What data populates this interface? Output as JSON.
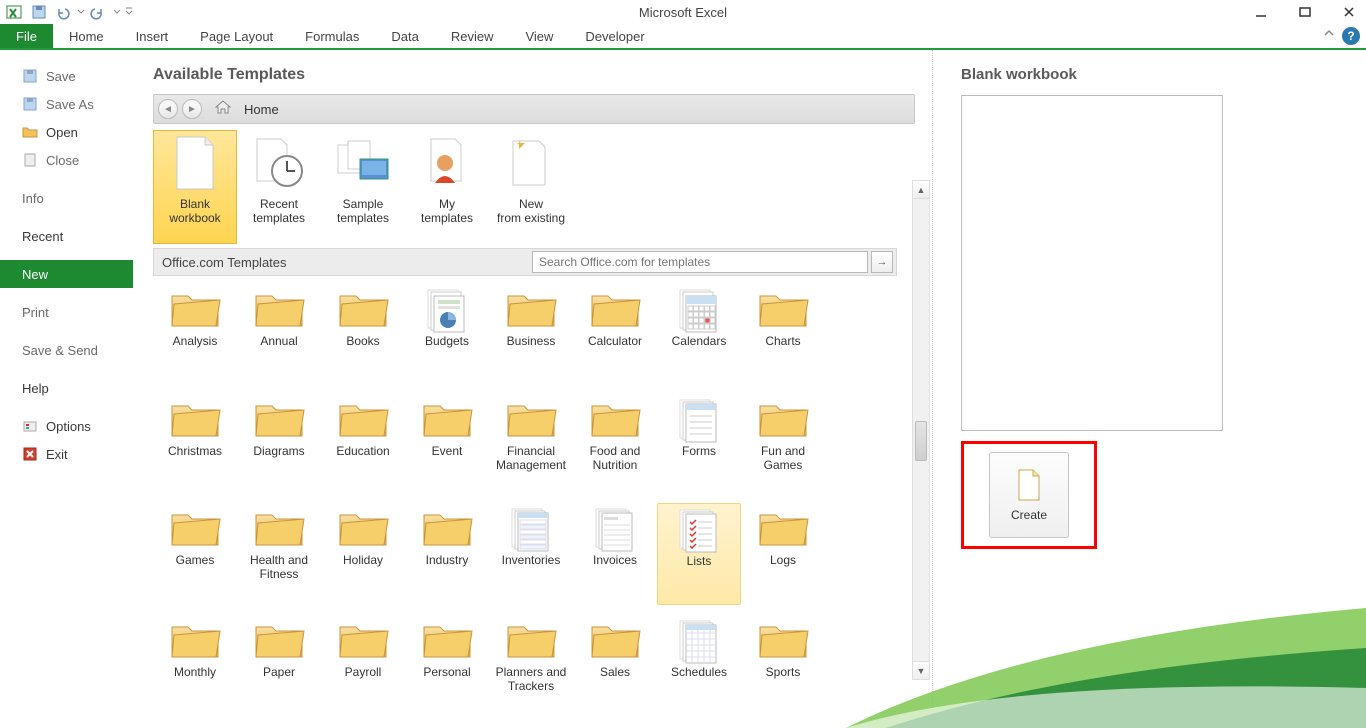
{
  "app": {
    "title": "Microsoft Excel"
  },
  "ribbon": {
    "file": "File",
    "tabs": [
      "Home",
      "Insert",
      "Page Layout",
      "Formulas",
      "Data",
      "Review",
      "View",
      "Developer"
    ]
  },
  "sidebar": {
    "save": "Save",
    "save_as": "Save As",
    "open": "Open",
    "close": "Close",
    "info": "Info",
    "recent": "Recent",
    "new": "New",
    "print": "Print",
    "save_send": "Save & Send",
    "help": "Help",
    "options": "Options",
    "exit": "Exit"
  },
  "templates": {
    "heading": "Available Templates",
    "breadcrumb": "Home",
    "top": [
      {
        "label": "Blank workbook",
        "icon": "blank-doc",
        "selected": true
      },
      {
        "label": "Recent templates",
        "icon": "recent-clock"
      },
      {
        "label": "Sample templates",
        "icon": "sample-gallery"
      },
      {
        "label": "My templates",
        "icon": "person-doc"
      },
      {
        "label": "New from existing",
        "icon": "star-doc"
      }
    ],
    "office_label": "Office.com Templates",
    "search_placeholder": "Search Office.com for templates",
    "categories": [
      {
        "label": "Analysis",
        "icon": "folder"
      },
      {
        "label": "Annual",
        "icon": "folder"
      },
      {
        "label": "Books",
        "icon": "folder"
      },
      {
        "label": "Budgets",
        "icon": "budget"
      },
      {
        "label": "Business",
        "icon": "folder"
      },
      {
        "label": "Calculator",
        "icon": "folder"
      },
      {
        "label": "Calendars",
        "icon": "calendar"
      },
      {
        "label": "Charts",
        "icon": "folder"
      },
      {
        "label": "Christmas",
        "icon": "folder"
      },
      {
        "label": "Diagrams",
        "icon": "folder"
      },
      {
        "label": "Education",
        "icon": "folder"
      },
      {
        "label": "Event",
        "icon": "folder"
      },
      {
        "label": "Financial Management",
        "icon": "folder"
      },
      {
        "label": "Food and Nutrition",
        "icon": "folder"
      },
      {
        "label": "Forms",
        "icon": "form"
      },
      {
        "label": "Fun and Games",
        "icon": "folder"
      },
      {
        "label": "Games",
        "icon": "folder"
      },
      {
        "label": "Health and Fitness",
        "icon": "folder"
      },
      {
        "label": "Holiday",
        "icon": "folder"
      },
      {
        "label": "Industry",
        "icon": "folder"
      },
      {
        "label": "Inventories",
        "icon": "inventory"
      },
      {
        "label": "Invoices",
        "icon": "invoice"
      },
      {
        "label": "Lists",
        "icon": "list",
        "selected": true
      },
      {
        "label": "Logs",
        "icon": "folder"
      },
      {
        "label": "Monthly",
        "icon": "folder"
      },
      {
        "label": "Paper",
        "icon": "folder"
      },
      {
        "label": "Payroll",
        "icon": "folder"
      },
      {
        "label": "Personal",
        "icon": "folder"
      },
      {
        "label": "Planners and Trackers",
        "icon": "folder"
      },
      {
        "label": "Sales",
        "icon": "folder"
      },
      {
        "label": "Schedules",
        "icon": "schedule"
      },
      {
        "label": "Sports",
        "icon": "folder"
      }
    ]
  },
  "preview": {
    "title": "Blank workbook",
    "create_label": "Create"
  }
}
